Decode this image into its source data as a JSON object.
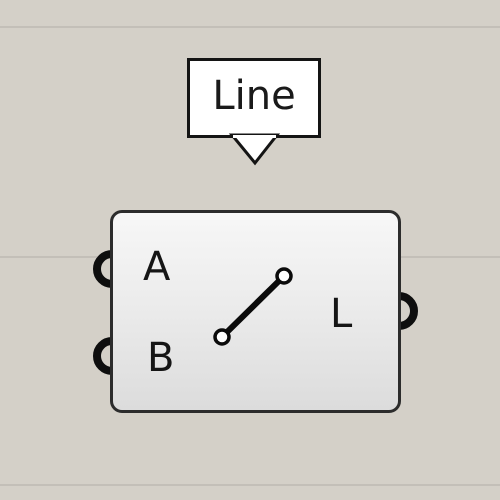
{
  "tooltip": {
    "text": "Line"
  },
  "component": {
    "icon": "line-segment-icon",
    "inputs": [
      {
        "label": "A"
      },
      {
        "label": "B"
      }
    ],
    "outputs": [
      {
        "label": "L"
      }
    ]
  },
  "colors": {
    "canvas": "#d4d0c8",
    "grid": "#c3bfb8",
    "component_border": "#2c2c2c",
    "text": "#151515"
  }
}
